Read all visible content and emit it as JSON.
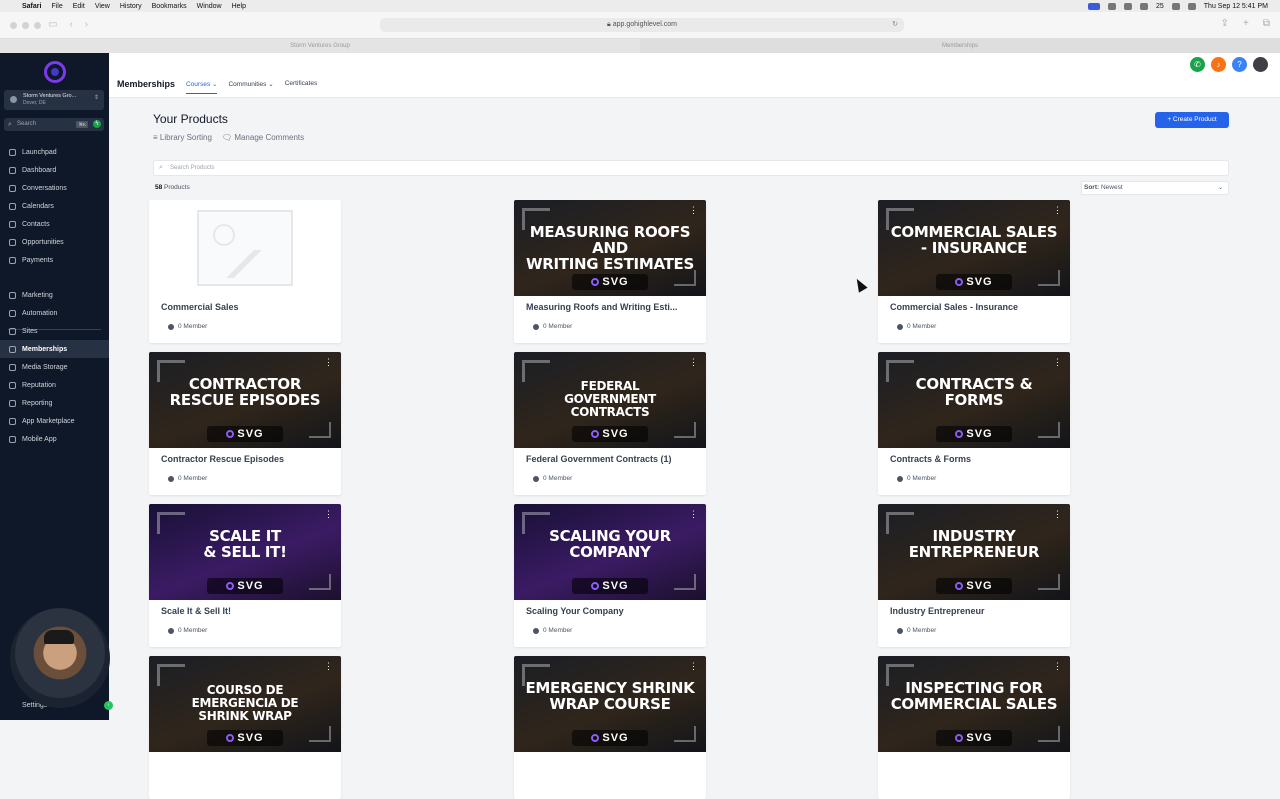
{
  "macbar": {
    "apple": "",
    "app": "Safari",
    "menus": [
      "File",
      "Edit",
      "View",
      "History",
      "Bookmarks",
      "Window",
      "Help"
    ],
    "wifi_count": "25",
    "datetime": "Thu Sep 12  5:41 PM"
  },
  "browser": {
    "url": "app.gohighlevel.com",
    "tabs": [
      "Storm Ventures Group",
      "Memberships"
    ]
  },
  "sidebar": {
    "account_name": "Storm Ventures Gro...",
    "account_location": "Dover, DE",
    "search_placeholder": "Search",
    "search_shortcut": "⌘K",
    "items": [
      {
        "label": "Launchpad"
      },
      {
        "label": "Dashboard"
      },
      {
        "label": "Conversations"
      },
      {
        "label": "Calendars"
      },
      {
        "label": "Contacts"
      },
      {
        "label": "Opportunities"
      },
      {
        "label": "Payments"
      }
    ],
    "items2": [
      {
        "label": "Marketing"
      },
      {
        "label": "Automation"
      },
      {
        "label": "Sites"
      },
      {
        "label": "Memberships"
      },
      {
        "label": "Media Storage"
      },
      {
        "label": "Reputation"
      },
      {
        "label": "Reporting"
      },
      {
        "label": "App Marketplace"
      },
      {
        "label": "Mobile App"
      }
    ],
    "settings": "Settings"
  },
  "topbar": {
    "title": "Memberships",
    "tabs": [
      "Courses",
      "Communities",
      "Certificates"
    ]
  },
  "main": {
    "heading": "Your Products",
    "library_sorting": "Library Sorting",
    "manage_comments": "Manage Comments",
    "create_button": "+ Create Product",
    "search_placeholder": "Search Products",
    "count_num": "58",
    "count_label": "Products",
    "sort_label": "Sort:",
    "sort_value": "Newest"
  },
  "products": [
    {
      "name": "Commercial Sales",
      "members": "0 Member",
      "thumb": ""
    },
    {
      "name": "Measuring Roofs and Writing Esti...",
      "members": "0 Member",
      "thumb": "MEASURING ROOFS AND\nWRITING ESTIMATES"
    },
    {
      "name": "Commercial Sales - Insurance",
      "members": "0 Member",
      "thumb": "COMMERCIAL SALES\n- INSURANCE"
    },
    {
      "name": "Contractor Rescue Episodes",
      "members": "0 Member",
      "thumb": "CONTRACTOR\nRESCUE EPISODES"
    },
    {
      "name": "Federal Government Contracts (1)",
      "members": "0 Member",
      "thumb": "FEDERAL\nGOVERNMENT\nCONTRACTS"
    },
    {
      "name": "Contracts & Forms",
      "members": "0 Member",
      "thumb": "CONTRACTS &\nFORMS"
    },
    {
      "name": "Scale It & Sell It!",
      "members": "0 Member",
      "thumb": "SCALE IT\n& SELL IT!"
    },
    {
      "name": "Scaling Your Company",
      "members": "0 Member",
      "thumb": "SCALING YOUR\nCOMPANY"
    },
    {
      "name": "Industry Entrepreneur",
      "members": "0 Member",
      "thumb": "INDUSTRY\nENTREPRENEUR"
    },
    {
      "name": "",
      "members": "",
      "thumb": "COURSO DE\nEMERGENCIA DE\nSHRINK WRAP"
    },
    {
      "name": "",
      "members": "",
      "thumb": "EMERGENCY SHRINK\nWRAP COURSE"
    },
    {
      "name": "",
      "members": "",
      "thumb": "INSPECTING FOR\nCOMMERCIAL SALES"
    }
  ],
  "brand_text": "SVG",
  "colors": {
    "sidebar": "#0f1828",
    "accent": "#2563eb",
    "purple": "#7c3aed"
  }
}
